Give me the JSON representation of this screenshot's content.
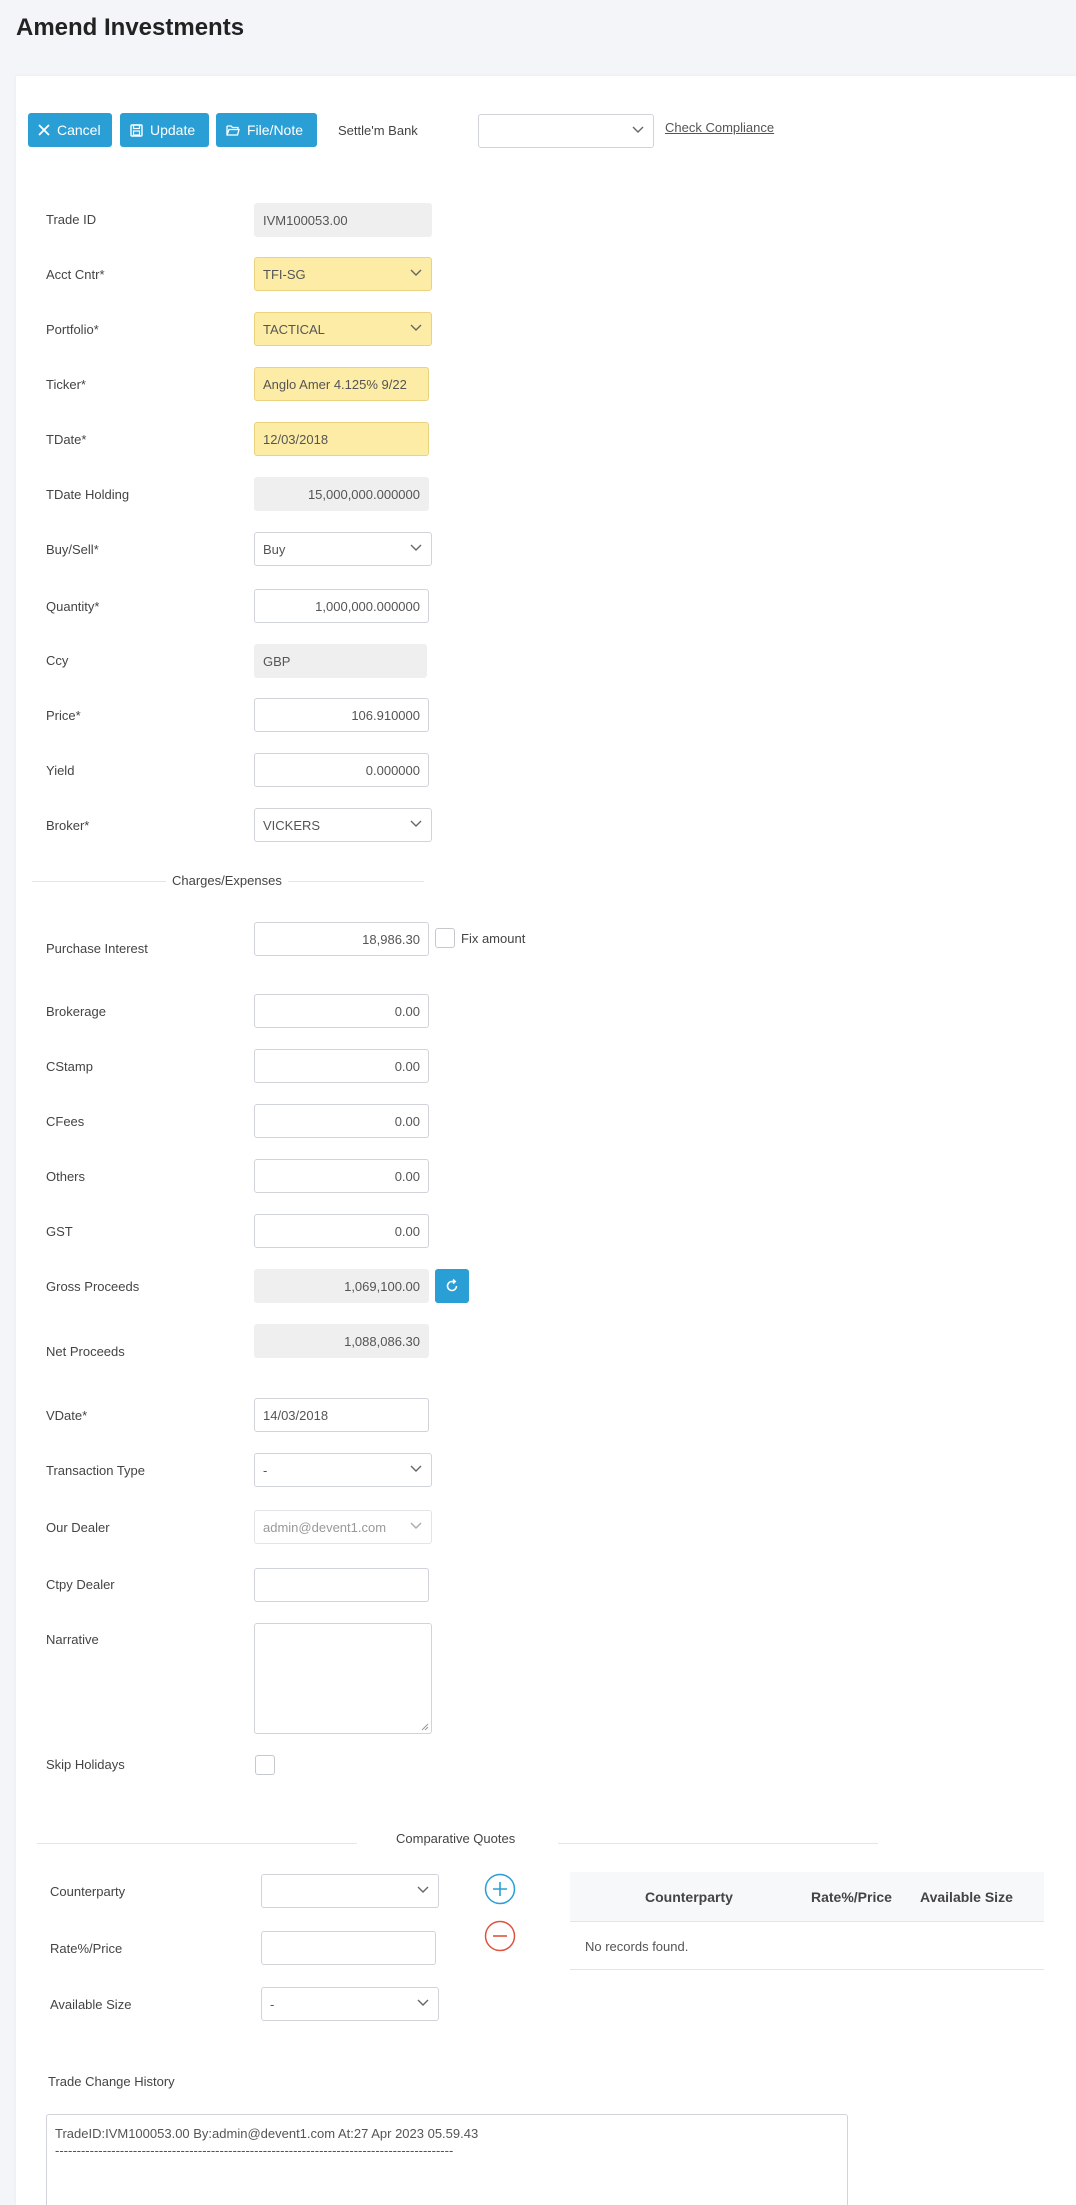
{
  "page": {
    "title": "Amend Investments"
  },
  "toolbar": {
    "cancel_label": "Cancel",
    "update_label": "Update",
    "file_note_label": "File/Note",
    "settle_bank_label": "Settle'm Bank",
    "settle_bank_value": "",
    "check_compliance_label": "Check Compliance"
  },
  "form": {
    "trade_id": {
      "label": "Trade ID",
      "value": "IVM100053.00"
    },
    "acct_cntr": {
      "label": "Acct Cntr*",
      "value": "TFI-SG"
    },
    "portfolio": {
      "label": "Portfolio*",
      "value": "TACTICAL"
    },
    "ticker": {
      "label": "Ticker*",
      "value": "Anglo Amer 4.125% 9/22"
    },
    "tdate": {
      "label": "TDate*",
      "value": "12/03/2018"
    },
    "tdate_holding": {
      "label": "TDate Holding",
      "value": "15,000,000.000000"
    },
    "buy_sell": {
      "label": "Buy/Sell*",
      "value": "Buy"
    },
    "quantity": {
      "label": "Quantity*",
      "value": "1,000,000.000000"
    },
    "ccy": {
      "label": "Ccy",
      "value": "GBP"
    },
    "price": {
      "label": "Price*",
      "value": "106.910000"
    },
    "yield": {
      "label": "Yield",
      "value": "0.000000"
    },
    "broker": {
      "label": "Broker*",
      "value": "VICKERS"
    }
  },
  "charges": {
    "section_title": "Charges/Expenses",
    "purchase_interest": {
      "label": "Purchase Interest",
      "value": "18,986.30"
    },
    "fix_amount_label": "Fix amount",
    "brokerage": {
      "label": "Brokerage",
      "value": "0.00"
    },
    "cstamp": {
      "label": "CStamp",
      "value": "0.00"
    },
    "cfees": {
      "label": "CFees",
      "value": "0.00"
    },
    "others": {
      "label": "Others",
      "value": "0.00"
    },
    "gst": {
      "label": "GST",
      "value": "0.00"
    },
    "gross_proceeds": {
      "label": "Gross Proceeds",
      "value": "1,069,100.00"
    },
    "net_proceeds": {
      "label": "Net Proceeds",
      "value": "1,088,086.30"
    },
    "vdate": {
      "label": "VDate*",
      "value": "14/03/2018"
    },
    "transaction_type": {
      "label": "Transaction Type",
      "value": "-"
    },
    "our_dealer": {
      "label": "Our Dealer",
      "value": "admin@devent1.com"
    },
    "ctpy_dealer": {
      "label": "Ctpy Dealer",
      "value": ""
    },
    "narrative": {
      "label": "Narrative",
      "value": ""
    },
    "skip_holidays": {
      "label": "Skip Holidays",
      "checked": false
    }
  },
  "quotes": {
    "section_title": "Comparative Quotes",
    "counterparty": {
      "label": "Counterparty",
      "value": ""
    },
    "rate_price": {
      "label": "Rate%/Price",
      "value": ""
    },
    "available_size": {
      "label": "Available Size",
      "value": "-"
    },
    "table": {
      "columns": [
        "Counterparty",
        "Rate%/Price",
        "Available Size"
      ],
      "empty_message": "No records found."
    }
  },
  "history": {
    "label": "Trade Change History",
    "line1": "TradeID:IVM100053.00 By:admin@devent1.com At:27 Apr 2023 05.59.43",
    "line2": "--------------------------------------------------------------------------------------------"
  },
  "colors": {
    "primary": "#2a9fd6",
    "required_highlight": "#fdeca6",
    "readonly_bg": "#efefef",
    "remove": "#e0533d"
  },
  "icons": {
    "cancel": "close-icon",
    "update": "save-icon",
    "file_note": "folder-open-icon",
    "recalc": "refresh-icon",
    "add_quote": "plus-circle-icon",
    "remove_quote": "minus-circle-icon",
    "dropdown": "chevron-down-icon"
  }
}
